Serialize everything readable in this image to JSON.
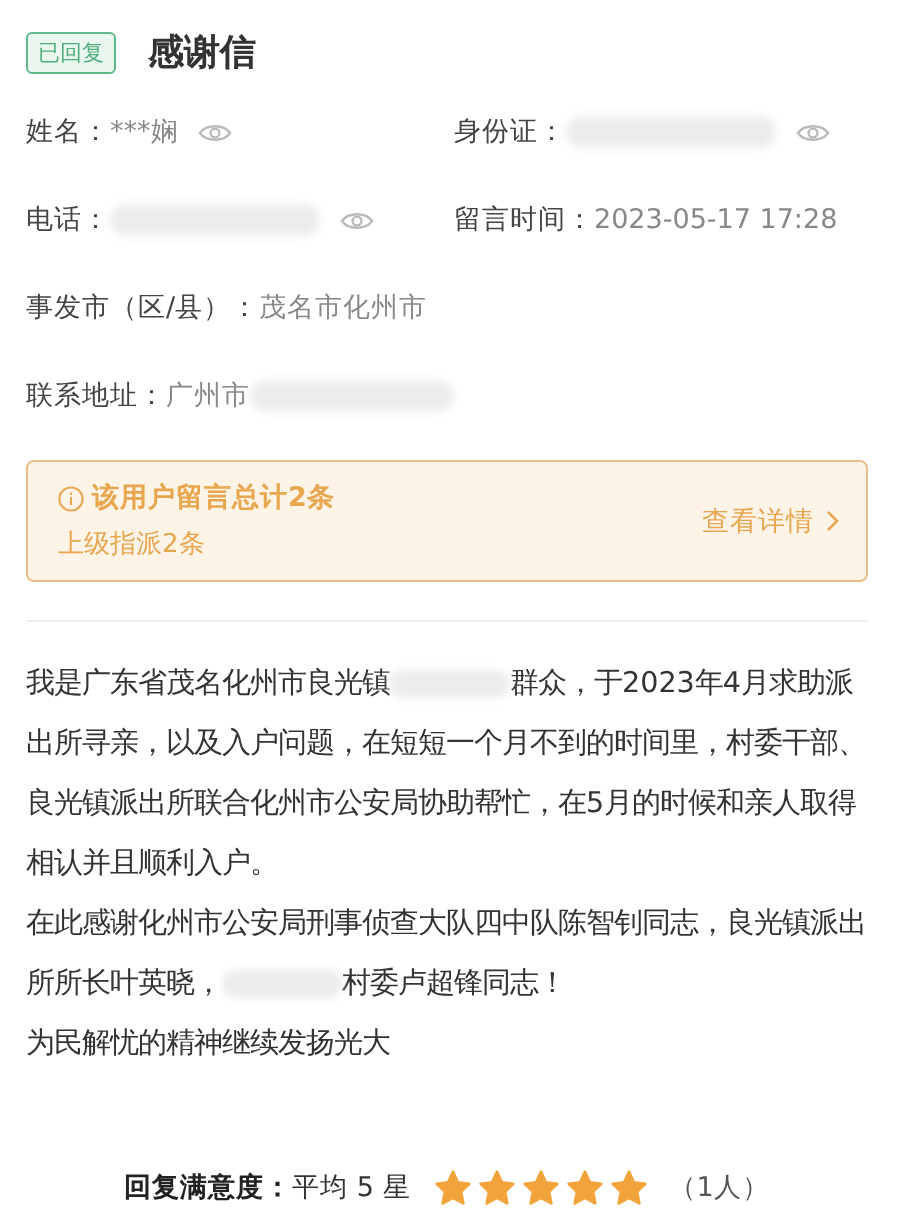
{
  "status_tag": "已回复",
  "title": "感谢信",
  "field_rows": [
    [
      {
        "label": "姓名：",
        "segments": [
          {
            "kind": "text",
            "text": "***娴"
          }
        ],
        "eye": true
      },
      {
        "label": "身份证：",
        "segments": [
          {
            "kind": "redacted"
          }
        ],
        "eye": true
      }
    ],
    [
      {
        "label": "电话：",
        "segments": [
          {
            "kind": "redacted"
          }
        ],
        "eye": true
      },
      {
        "label": "留言时间：",
        "segments": [
          {
            "kind": "text",
            "text": "2023-05-17 17:28"
          }
        ],
        "eye": false
      }
    ],
    [
      {
        "label": "事发市（区/县）：",
        "segments": [
          {
            "kind": "text",
            "text": "茂名市化州市"
          }
        ],
        "eye": false
      }
    ],
    [
      {
        "label": "联系地址：",
        "segments": [
          {
            "kind": "text",
            "text": "广州市"
          },
          {
            "kind": "redacted"
          }
        ],
        "eye": false
      }
    ]
  ],
  "notice": {
    "title": "该用户留言总计2条",
    "subtitle": "上级指派2条",
    "link": "查看详情"
  },
  "body": [
    [
      {
        "kind": "text",
        "text": "我是广东省茂名化州市良光镇"
      },
      {
        "kind": "redacted"
      },
      {
        "kind": "text",
        "text": "群众，于2023年4月求助派出所寻亲，以及入户问题，在短短一个月不到的时间里，村委干部、良光镇派出所联合化州市公安局协助帮忙，在5月的时候和亲人取得相认并且顺利入户。"
      }
    ],
    [
      {
        "kind": "text",
        "text": "在此感谢化州市公安局刑事侦查大队四中队陈智钊同志，良光镇派出所所长叶英晓，"
      },
      {
        "kind": "redacted"
      },
      {
        "kind": "text",
        "text": "村委卢超锋同志！"
      }
    ],
    [
      {
        "kind": "text",
        "text": "为民解忧的精神继续发扬光大"
      }
    ]
  ],
  "rating": {
    "label": "回复满意度：",
    "average": "平均 5  星",
    "stars": 5,
    "count": "（1人）"
  }
}
